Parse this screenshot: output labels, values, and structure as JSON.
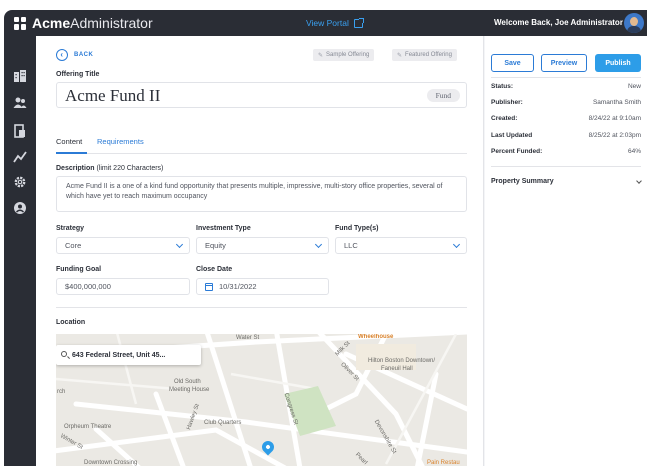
{
  "app": {
    "logo_bold": "Acme",
    "logo_light": "Administrator",
    "view_portal": "View Portal",
    "welcome": "Welcome Back, Joe Administrator"
  },
  "sidebar": {
    "items": [
      {
        "icon": "building-icon"
      },
      {
        "icon": "users-icon"
      },
      {
        "icon": "document-icon"
      },
      {
        "icon": "analytics-icon"
      },
      {
        "icon": "settings-icon"
      },
      {
        "icon": "profile-icon"
      }
    ]
  },
  "header": {
    "back_label": "BACK",
    "tags": [
      "Sample Offering",
      "Featured Offering"
    ]
  },
  "offering": {
    "title_label": "Offering Title",
    "title": "Acme Fund II",
    "type_pill": "Fund"
  },
  "tabs": [
    {
      "label": "Content",
      "active": true
    },
    {
      "label": "Requirements",
      "active": false
    }
  ],
  "description": {
    "label": "Description",
    "hint": "(limit 220 Characters)",
    "text": "Acme Fund II is a one of a kind fund opportunity that presents multiple, impressive, multi-story office properties, several of which have yet to reach maximum occupancy"
  },
  "fields": {
    "strategy_label": "Strategy",
    "strategy_value": "Core",
    "investment_type_label": "Investment Type",
    "investment_type_value": "Equity",
    "fund_types_label": "Fund Type(s)",
    "fund_types_value": "LLC",
    "funding_goal_label": "Funding Goal",
    "funding_goal_value": "$400,000,000",
    "close_date_label": "Close Date",
    "close_date_value": "10/31/2022"
  },
  "location": {
    "label": "Location",
    "search_value": "643 Federal Street, Unit 45...",
    "map_labels": [
      "Water St",
      "Milk St",
      "Wheelhouse",
      "Hilton Boston Downtown/",
      "Faneuil Hall",
      "Old South",
      "Meeting House",
      "Club Quarters",
      "Congress St",
      "Orpheum Theatre",
      "Pain Restau",
      "Winter St",
      "Devonshire St",
      "Hawley St",
      "Oliver St",
      "Downtown Crossing",
      "rch",
      "Pearl"
    ]
  },
  "actions": {
    "save": "Save",
    "preview": "Preview",
    "publish": "Publish"
  },
  "status_panel": {
    "rows": [
      {
        "key": "Status:",
        "value": "New"
      },
      {
        "key": "Publisher:",
        "value": "Samantha Smith"
      },
      {
        "key": "Created:",
        "value": "8/24/22 at 9:10am"
      },
      {
        "key": "Last Updated",
        "value": "8/25/22 at 2:03pm"
      },
      {
        "key": "Percent Funded:",
        "value": "64%"
      }
    ],
    "summary_label": "Property Summary"
  },
  "colors": {
    "accent": "#2b7bd6",
    "publish": "#2d9de8",
    "chrome": "#2a2d35"
  }
}
